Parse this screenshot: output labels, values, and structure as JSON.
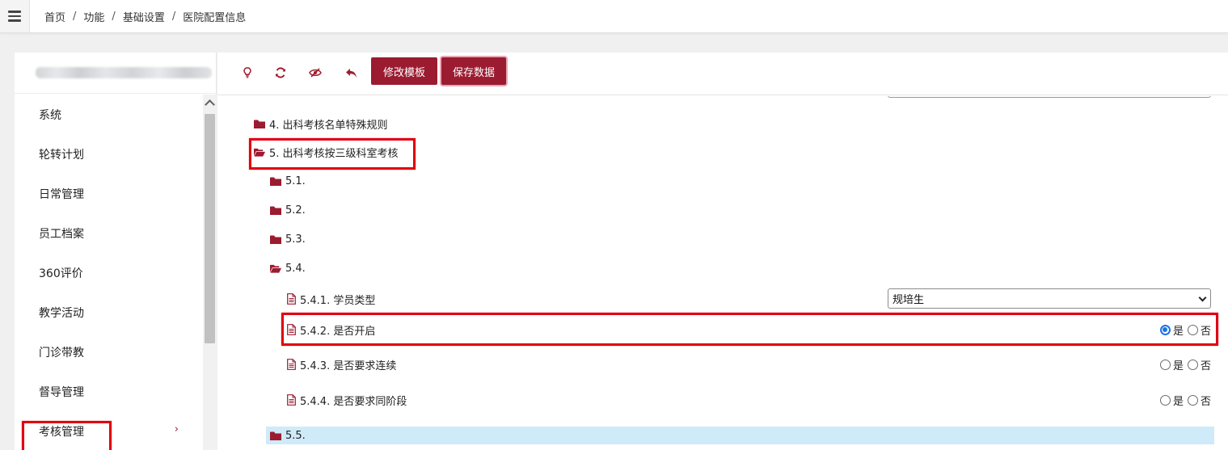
{
  "breadcrumb": {
    "items": [
      "首页",
      "功能",
      "基础设置",
      "医院配置信息"
    ],
    "separator": "/"
  },
  "sidebar": {
    "items": [
      {
        "label": "系统"
      },
      {
        "label": "轮转计划"
      },
      {
        "label": "日常管理"
      },
      {
        "label": "员工档案"
      },
      {
        "label": "360评价"
      },
      {
        "label": "教学活动"
      },
      {
        "label": "门诊带教"
      },
      {
        "label": "督导管理"
      },
      {
        "label": "考核管理",
        "chevron": "›"
      }
    ]
  },
  "toolbar": {
    "icons": [
      "lightbulb-icon",
      "refresh-icon",
      "eye-slash-icon",
      "reply-icon"
    ],
    "edit_template_label": "修改模板",
    "save_data_label": "保存数据"
  },
  "tree": {
    "row4": "4. 出科考核名单特殊规则",
    "row5": "5. 出科考核按三级科室考核",
    "row51": "5.1.",
    "row52": "5.2.",
    "row53": "5.3.",
    "row54": "5.4.",
    "row541": "5.4.1. 学员类型",
    "row541_value": "规培生",
    "row542": "5.4.2. 是否开启",
    "row543": "5.4.3. 是否要求连续",
    "row544": "5.4.4. 是否要求同阶段",
    "row55": "5.5.",
    "yes": "是",
    "no": "否"
  },
  "colors": {
    "accent": "#9b1b30",
    "annotation": "#e00012",
    "highlight_row": "#cfeaf8",
    "radio_checked": "#1a73e8"
  }
}
